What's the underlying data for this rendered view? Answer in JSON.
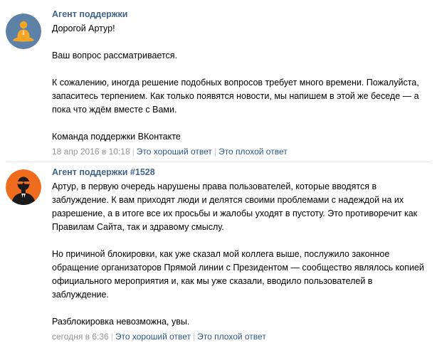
{
  "messages": [
    {
      "author": "Агент поддержки",
      "avatar_icon": "meditating-person-icon",
      "paragraphs": [
        "Дорогой Артур!",
        "Ваш вопрос рассматривается.",
        "К сожалению, иногда решение подобных вопросов требует много времени. Пожалуйста, запаситесь терпением. Как только появятся новости, мы напишем в этой же беседе — а пока что ждём вместе с Вами.",
        "Команда поддержки ВКонтакте"
      ],
      "timestamp": "18 апр 2016 в 10:18",
      "good_answer": "Это хороший ответ",
      "bad_answer": "Это плохой ответ"
    },
    {
      "author": "Агент поддержки #1528",
      "avatar_icon": "agent-in-sunglasses-icon",
      "paragraphs": [
        "Артур, в первую очередь нарушены права пользователей, которые вводятся в заблуждение. К вам приходят люди и делятся своими проблемами с надеждой на их разрешение, а в итоге все их просьбы и жалобы уходят в пустоту. Это противоречит как Правилам Сайта, так и здравому смыслу.",
        "Но причиной блокировки, как уже сказал мой коллега выше, послужило законное обращение организаторов Прямой линии с Президентом — сообщество являлось копией официального мероприятия и, как мы уже сказали, вводило пользователей в заблуждение.",
        "Разблокировка невозможна, увы."
      ],
      "timestamp": "сегодня в 6:36",
      "good_answer": "Это хороший ответ",
      "bad_answer": "Это плохой ответ"
    }
  ],
  "colors": {
    "author_link": "#42648b",
    "action_link": "#2a5885",
    "meta_text": "#939393",
    "avatar_1_bg": "#5e81a8",
    "avatar_1_figure": "#f5a623",
    "avatar_2_bg": "#ef6c1f"
  }
}
